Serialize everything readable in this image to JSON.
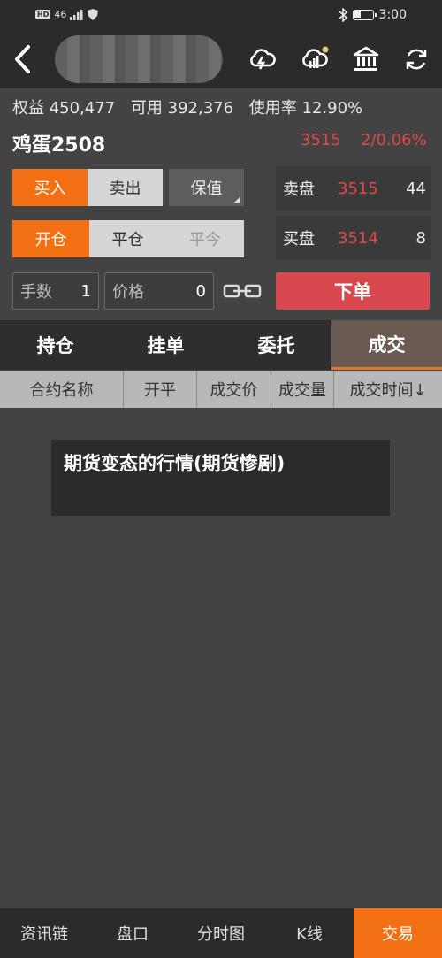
{
  "status_bar": {
    "network": "46",
    "time": "3:00"
  },
  "nav": {
    "icons": [
      "cloud-lightning-icon",
      "cloud-signal-icon",
      "bank-icon",
      "refresh-icon"
    ]
  },
  "account": {
    "equity": "权益 450,477",
    "available": "可用 392,376",
    "usage": "使用率 12.90%"
  },
  "instrument": {
    "name": "鸡蛋2508",
    "last_price": "3515",
    "change": "2/0.06%"
  },
  "trade_buttons": {
    "buy": "买入",
    "sell": "卖出",
    "hedge": "保值",
    "open": "开仓",
    "close": "平仓",
    "close_today": "平今"
  },
  "quote": {
    "ask_label": "卖盘",
    "ask_price": "3515",
    "ask_vol": "44",
    "bid_label": "买盘",
    "bid_price": "3514",
    "bid_vol": "8"
  },
  "inputs": {
    "qty_label": "手数",
    "qty_value": "1",
    "price_label": "价格",
    "price_value": "0"
  },
  "order_button": "下单",
  "tabs": [
    "持仓",
    "挂单",
    "委托",
    "成交"
  ],
  "active_tab": 3,
  "table_headers": [
    "合约名称",
    "开平",
    "成交价",
    "成交量",
    "成交时间↓"
  ],
  "overlay_text": "期货变态的行情(期货惨剧)",
  "bottom_nav": [
    "资讯链",
    "盘口",
    "分时图",
    "K线",
    "交易"
  ],
  "colors": {
    "accent": "#f36f13",
    "price_red": "#e04848",
    "order_red": "#d8484f"
  }
}
